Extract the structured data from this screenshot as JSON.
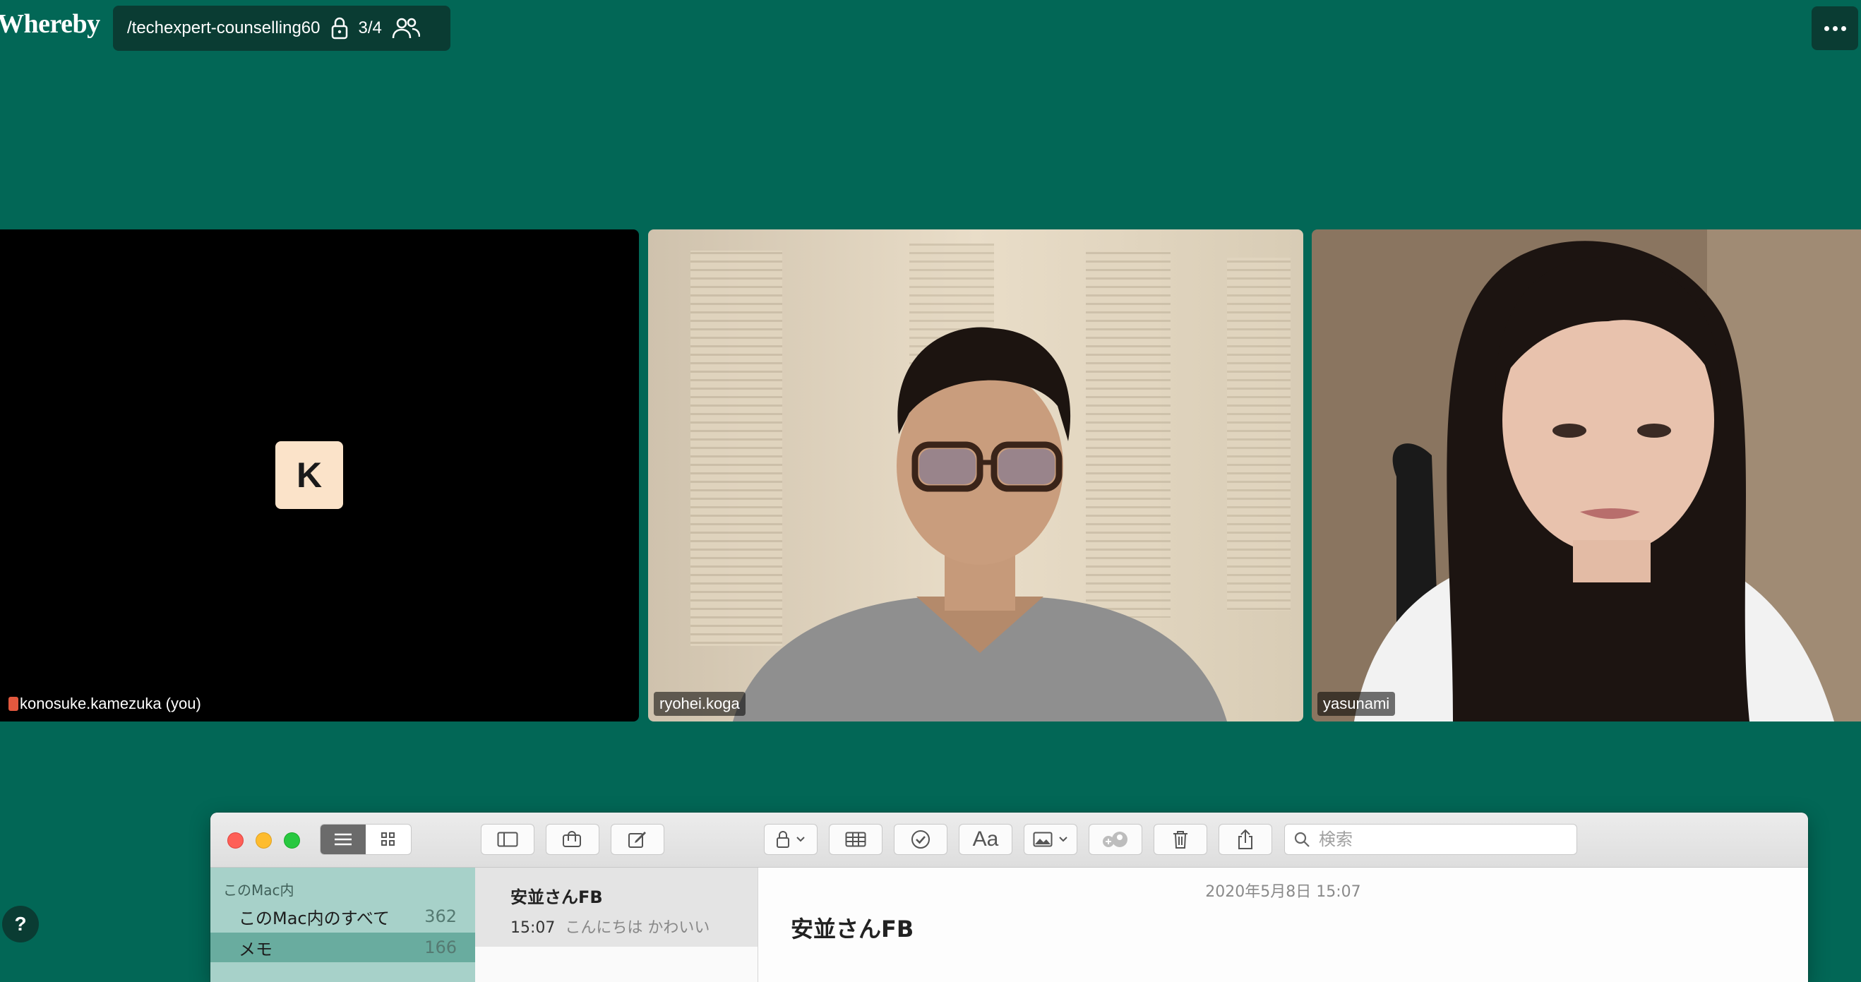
{
  "app": {
    "logo": "Whereby"
  },
  "room": {
    "name": "/techexpert-counselling60",
    "participant_count": "3/4"
  },
  "participants": [
    {
      "name": "konosuke.kamezuka (you)",
      "initial": "K"
    },
    {
      "name": "ryohei.koga"
    },
    {
      "name": "yasunami"
    }
  ],
  "help": {
    "label": "?"
  },
  "notes": {
    "toolbar": {
      "font_label": "Aa",
      "search_placeholder": "検索"
    },
    "sidebar": {
      "section": "このMac内",
      "items": [
        {
          "label": "このMac内のすべて",
          "count": "362"
        },
        {
          "label": "メモ",
          "count": "166"
        }
      ]
    },
    "list": [
      {
        "title": "安並さんFB",
        "time": "15:07",
        "preview": "こんにちは かわいい"
      }
    ],
    "editor": {
      "date": "2020年5月8日 15:07",
      "title": "安並さんFB"
    }
  }
}
